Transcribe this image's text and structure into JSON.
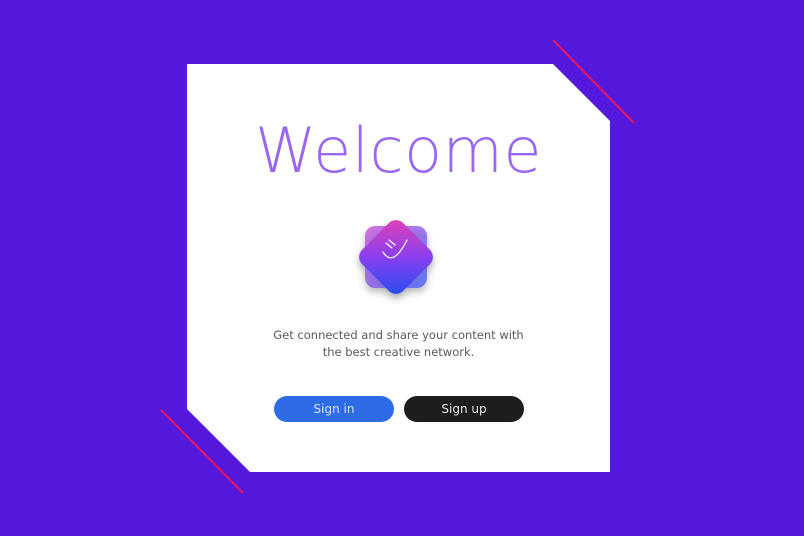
{
  "card": {
    "title": "Welcome",
    "tagline_line1": "Get connected  and share your content with",
    "tagline_line2": "the best creative network."
  },
  "logo": {
    "icon": "smile-diamond-icon"
  },
  "buttons": {
    "sign_in_label": "Sign in",
    "sign_up_label": "Sign up"
  },
  "colors": {
    "background": "#5518dd",
    "card": "#ffffff",
    "title": "#9b67f2",
    "accent_line": "#e8155f",
    "sign_in": "#2e6be6",
    "sign_up": "#1d1d1d"
  }
}
